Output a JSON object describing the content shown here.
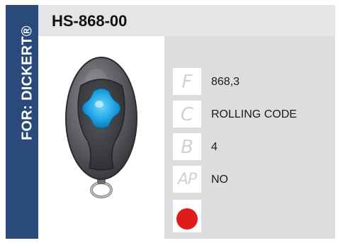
{
  "side_label": "FOR: DICKERT®",
  "header": {
    "title": "HS-868-00"
  },
  "specs": [
    {
      "code": "F",
      "value": "868,3",
      "icon": "frequency-icon"
    },
    {
      "code": "C",
      "value": "ROLLING CODE",
      "icon": "coding-icon"
    },
    {
      "code": "B",
      "value": "4",
      "icon": "buttons-icon"
    },
    {
      "code": "AP",
      "value": "NO",
      "icon": "auto-programming-icon"
    }
  ],
  "indicator": {
    "icon": "led-color-icon",
    "color": "#e01b1b"
  },
  "colors": {
    "brand": "#2b4a7c",
    "header_bg": "#e4e5e6",
    "panel_bg": "#dcdddf",
    "button": "#29aee8"
  }
}
